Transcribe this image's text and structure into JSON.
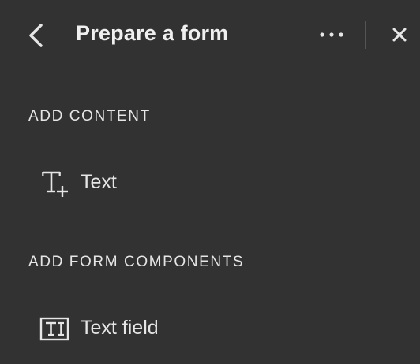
{
  "colors": {
    "panel_background": "#323232",
    "text": "#e6e6e6",
    "divider": "#555555"
  },
  "header": {
    "title": "Prepare a form",
    "back_icon": "chevron-left-icon",
    "more_icon": "more-horizontal-icon",
    "close_icon": "close-icon"
  },
  "sections": [
    {
      "heading": "ADD CONTENT",
      "items": [
        {
          "label": "Text",
          "icon": "add-text-icon"
        }
      ]
    },
    {
      "heading": "ADD FORM COMPONENTS",
      "items": [
        {
          "label": "Text field",
          "icon": "text-field-icon"
        }
      ]
    }
  ]
}
